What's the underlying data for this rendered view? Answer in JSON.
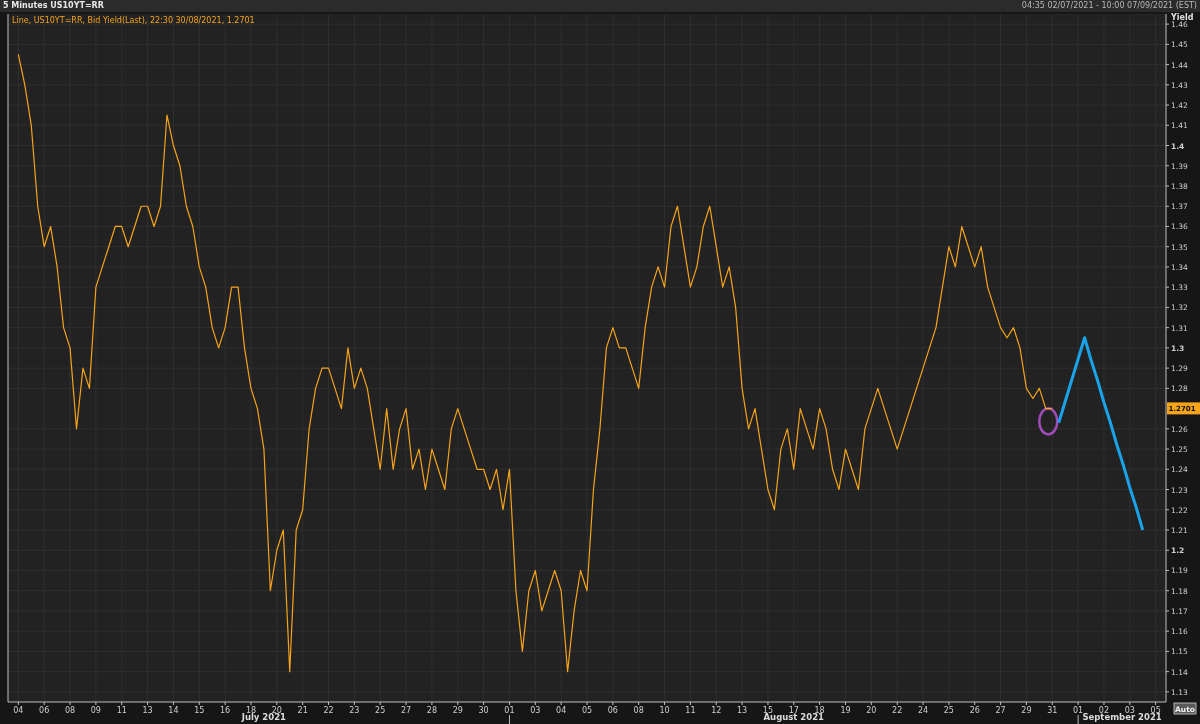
{
  "header": {
    "title": "5 Minutes US10YT=RR",
    "range": "04:35 02/07/2021 - 10:00 07/09/2021 (EST)"
  },
  "legend": "Line, US10YT=RR, Bid Yield(Last), 22:30 30/08/2021, 1.2701",
  "last_value_tag": "1.2701",
  "months": [
    "July 2021",
    "August 2021",
    "September 2021"
  ],
  "auto_button": "Auto",
  "chart_data": {
    "type": "line",
    "grid": true,
    "ylabel": "Yield",
    "ylim": [
      1.125,
      1.465
    ],
    "yticks": [
      1.46,
      1.45,
      1.44,
      1.43,
      1.42,
      1.41,
      1.4,
      1.39,
      1.38,
      1.37,
      1.36,
      1.35,
      1.34,
      1.33,
      1.32,
      1.31,
      1.3,
      1.29,
      1.28,
      1.26,
      1.25,
      1.24,
      1.23,
      1.22,
      1.21,
      1.2,
      1.19,
      1.18,
      1.17,
      1.16,
      1.15,
      1.14,
      1.13
    ],
    "categories": [
      "04",
      null,
      null,
      null,
      "06",
      null,
      null,
      null,
      "08",
      null,
      null,
      null,
      "09",
      null,
      null,
      null,
      "11",
      null,
      null,
      null,
      "13",
      null,
      null,
      null,
      "14",
      null,
      null,
      null,
      "15",
      null,
      null,
      null,
      "16",
      null,
      null,
      null,
      "18",
      null,
      null,
      null,
      "20",
      null,
      null,
      null,
      "21",
      null,
      null,
      null,
      "22",
      null,
      null,
      null,
      "23",
      null,
      null,
      null,
      "25",
      null,
      null,
      null,
      "27",
      null,
      null,
      null,
      "28",
      null,
      null,
      null,
      "29",
      null,
      null,
      null,
      "30",
      null,
      null,
      null,
      "01",
      null,
      null,
      null,
      "03",
      null,
      null,
      null,
      "04",
      null,
      null,
      null,
      "05",
      null,
      null,
      null,
      "06",
      null,
      null,
      null,
      "08",
      null,
      null,
      null,
      "10",
      null,
      null,
      null,
      "11",
      null,
      null,
      null,
      "12",
      null,
      null,
      null,
      "13",
      null,
      null,
      null,
      "15",
      null,
      null,
      null,
      "17",
      null,
      null,
      null,
      "18",
      null,
      null,
      null,
      "19",
      null,
      null,
      null,
      "20",
      null,
      null,
      null,
      "22",
      null,
      null,
      null,
      "24",
      null,
      null,
      null,
      "25",
      null,
      null,
      null,
      "26",
      null,
      null,
      null,
      "27",
      null,
      null,
      null,
      "29",
      null,
      null,
      null,
      "31",
      null,
      null,
      null,
      "01",
      null,
      null,
      null,
      "02",
      null,
      null,
      null,
      "03",
      null,
      null,
      null,
      "05"
    ],
    "series": [
      {
        "color": "#f5a31a",
        "values": [
          1.445,
          1.43,
          1.41,
          1.37,
          1.35,
          1.36,
          1.34,
          1.31,
          1.3,
          1.26,
          1.29,
          1.28,
          1.33,
          1.34,
          1.35,
          1.36,
          1.36,
          1.35,
          1.36,
          1.37,
          1.37,
          1.36,
          1.37,
          1.415,
          1.4,
          1.39,
          1.37,
          1.36,
          1.34,
          1.33,
          1.31,
          1.3,
          1.31,
          1.33,
          1.33,
          1.3,
          1.28,
          1.27,
          1.25,
          1.18,
          1.2,
          1.21,
          1.14,
          1.21,
          1.22,
          1.26,
          1.28,
          1.29,
          1.29,
          1.28,
          1.27,
          1.3,
          1.28,
          1.29,
          1.28,
          1.26,
          1.24,
          1.27,
          1.24,
          1.26,
          1.27,
          1.24,
          1.25,
          1.23,
          1.25,
          1.24,
          1.23,
          1.26,
          1.27,
          1.26,
          1.25,
          1.24,
          1.24,
          1.23,
          1.24,
          1.22,
          1.24,
          1.18,
          1.15,
          1.18,
          1.19,
          1.17,
          1.18,
          1.19,
          1.18,
          1.14,
          1.17,
          1.19,
          1.18,
          1.23,
          1.26,
          1.3,
          1.31,
          1.3,
          1.3,
          1.29,
          1.28,
          1.31,
          1.33,
          1.34,
          1.33,
          1.36,
          1.37,
          1.35,
          1.33,
          1.34,
          1.36,
          1.37,
          1.35,
          1.33,
          1.34,
          1.32,
          1.28,
          1.26,
          1.27,
          1.25,
          1.23,
          1.22,
          1.25,
          1.26,
          1.24,
          1.27,
          1.26,
          1.25,
          1.27,
          1.26,
          1.24,
          1.23,
          1.25,
          1.24,
          1.23,
          1.26,
          1.27,
          1.28,
          1.27,
          1.26,
          1.25,
          1.26,
          1.27,
          1.28,
          1.29,
          1.3,
          1.31,
          1.33,
          1.35,
          1.34,
          1.36,
          1.35,
          1.34,
          1.35,
          1.33,
          1.32,
          1.31,
          1.305,
          1.31,
          1.3,
          1.28,
          1.275,
          1.28,
          1.27,
          1.2701,
          null,
          null,
          null,
          null,
          null,
          null,
          null,
          null,
          null,
          null,
          null,
          null,
          null,
          null,
          null,
          null
        ]
      },
      {
        "color": "#1aa3e8",
        "values": [
          null,
          null,
          null,
          null,
          null,
          null,
          null,
          null,
          null,
          null,
          null,
          null,
          null,
          null,
          null,
          null,
          null,
          null,
          null,
          null,
          null,
          null,
          null,
          null,
          null,
          null,
          null,
          null,
          null,
          null,
          null,
          null,
          null,
          null,
          null,
          null,
          null,
          null,
          null,
          null,
          null,
          null,
          null,
          null,
          null,
          null,
          null,
          null,
          null,
          null,
          null,
          null,
          null,
          null,
          null,
          null,
          null,
          null,
          null,
          null,
          null,
          null,
          null,
          null,
          null,
          null,
          null,
          null,
          null,
          null,
          null,
          null,
          null,
          null,
          null,
          null,
          null,
          null,
          null,
          null,
          null,
          null,
          null,
          null,
          null,
          null,
          null,
          null,
          null,
          null,
          null,
          null,
          null,
          null,
          null,
          null,
          null,
          null,
          null,
          null,
          null,
          null,
          null,
          null,
          null,
          null,
          null,
          null,
          null,
          null,
          null,
          null,
          null,
          null,
          null,
          null,
          null,
          null,
          null,
          null,
          null,
          null,
          null,
          null,
          null,
          null,
          null,
          null,
          null,
          null,
          null,
          null,
          null,
          null,
          null,
          null,
          null,
          null,
          null,
          null,
          null,
          null,
          null,
          null,
          null,
          null,
          null,
          null,
          null,
          null,
          null,
          null,
          null,
          null,
          null,
          null,
          null,
          null,
          null,
          null,
          null,
          1.263,
          1.2735,
          1.284,
          1.2945,
          1.305,
          1.294,
          1.284,
          1.273,
          1.263,
          1.252,
          1.242,
          1.231,
          1.221,
          1.21,
          null,
          null
        ]
      }
    ]
  }
}
